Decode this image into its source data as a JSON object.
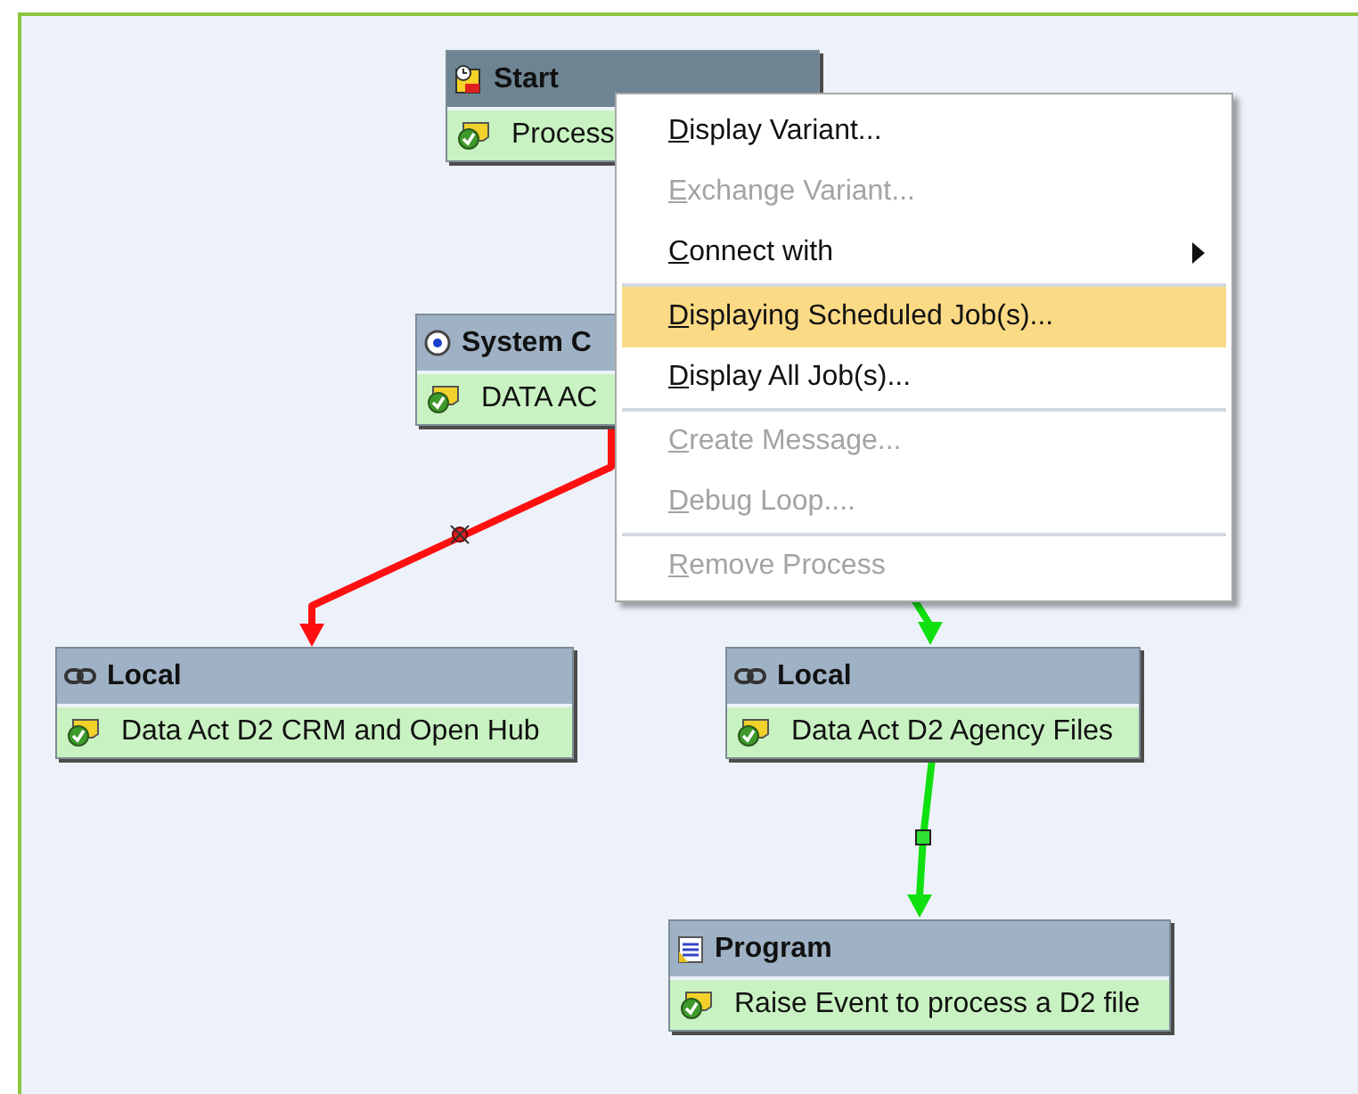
{
  "nodes": [
    {
      "kind": "start",
      "title": "Start",
      "text": "Process",
      "selected": true
    },
    {
      "kind": "system",
      "title": "System C",
      "text": "DATA AC",
      "selected": false
    },
    {
      "kind": "local",
      "title": "Local",
      "text": "Data Act D2 CRM and Open Hub",
      "selected": false
    },
    {
      "kind": "local",
      "title": "Local",
      "text": "Data Act D2 Agency Files",
      "selected": false
    },
    {
      "kind": "program",
      "title": "Program",
      "text": "Raise Event to process a D2 file",
      "selected": false
    }
  ],
  "edges": [
    {
      "kind": "error",
      "color": "#ff1010"
    },
    {
      "kind": "success",
      "color": "#10e010"
    },
    {
      "kind": "success",
      "color": "#10e010"
    }
  ],
  "context_menu": {
    "items": [
      {
        "kind": "item",
        "label": "Display Variant...",
        "disabled": false,
        "selected": false,
        "submenu": false
      },
      {
        "kind": "item",
        "label": "Exchange Variant...",
        "disabled": true,
        "selected": false,
        "submenu": false
      },
      {
        "kind": "item",
        "label": "Connect with",
        "disabled": false,
        "selected": false,
        "submenu": true
      },
      {
        "kind": "separator"
      },
      {
        "kind": "item",
        "label": "Displaying Scheduled Job(s)...",
        "disabled": false,
        "selected": true,
        "submenu": false
      },
      {
        "kind": "item",
        "label": "Display All Job(s)...",
        "disabled": false,
        "selected": false,
        "submenu": false
      },
      {
        "kind": "separator"
      },
      {
        "kind": "item",
        "label": "Create Message...",
        "disabled": true,
        "selected": false,
        "submenu": false
      },
      {
        "kind": "item",
        "label": "Debug Loop....",
        "disabled": true,
        "selected": false,
        "submenu": false
      },
      {
        "kind": "separator"
      },
      {
        "kind": "item",
        "label": "Remove Process",
        "disabled": true,
        "selected": false,
        "submenu": false
      }
    ]
  }
}
